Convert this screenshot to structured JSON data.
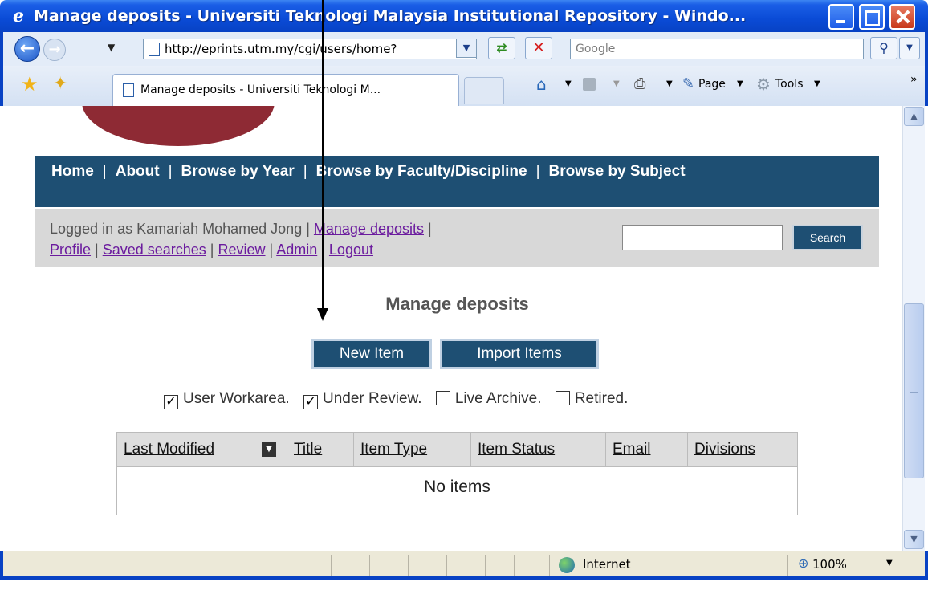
{
  "window": {
    "title": "Manage deposits - Universiti Teknologi Malaysia Institutional Repository - Windo..."
  },
  "toolbar": {
    "address": "http://eprints.utm.my/cgi/users/home?",
    "search_placeholder": "Google"
  },
  "tabs": [
    {
      "label": "Manage deposits - Universiti Teknologi M..."
    }
  ],
  "command_bar": {
    "page_label": "Page",
    "tools_label": "Tools"
  },
  "site_nav": {
    "items": [
      "Home",
      "About",
      "Browse by Year",
      "Browse by Faculty/Discipline",
      "Browse by Subject"
    ]
  },
  "login_bar": {
    "prefix": "Logged in as Kamariah Mohamed Jong",
    "links": [
      "Manage deposits",
      "Profile",
      "Saved searches",
      "Review",
      "Admin",
      "Logout"
    ],
    "search_button": "Search"
  },
  "main": {
    "title": "Manage deposits",
    "new_item_label": "New Item",
    "import_items_label": "Import Items",
    "filters": [
      {
        "label": "User Workarea.",
        "checked": true
      },
      {
        "label": "Under Review.",
        "checked": true
      },
      {
        "label": "Live Archive.",
        "checked": false
      },
      {
        "label": "Retired.",
        "checked": false
      }
    ],
    "table": {
      "columns": [
        "Last Modified",
        "Title",
        "Item Type",
        "Item Status",
        "Email",
        "Divisions"
      ],
      "empty_message": "No items"
    }
  },
  "statusbar": {
    "zone": "Internet",
    "zoom": "100%"
  }
}
